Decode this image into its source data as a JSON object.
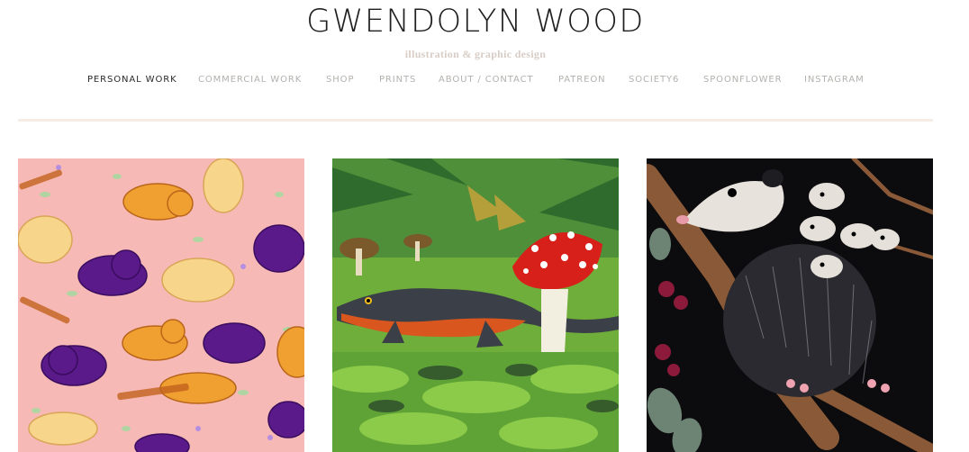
{
  "site": {
    "title": "GWENDOLYN WOOD",
    "tagline": "illustration & graphic design"
  },
  "nav": {
    "items": [
      {
        "label": "PERSONAL WORK",
        "active": true
      },
      {
        "label": "COMMERCIAL WORK",
        "active": false
      },
      {
        "label": "SHOP",
        "active": false
      },
      {
        "label": "PRINTS",
        "active": false
      },
      {
        "label": "ABOUT / CONTACT",
        "active": false
      },
      {
        "label": "PATREON",
        "active": false
      },
      {
        "label": "SOCIETY6",
        "active": false
      },
      {
        "label": "SPOONFLOWER",
        "active": false
      },
      {
        "label": "INSTAGRAM",
        "active": false
      }
    ]
  },
  "gallery": {
    "items": [
      {
        "subject": "cats-pattern"
      },
      {
        "subject": "newt-mushroom"
      },
      {
        "subject": "opossums"
      }
    ]
  },
  "colors": {
    "title": "#1e1e1e",
    "tagline": "#d8cdc6",
    "nav_inactive": "#b4b1ad",
    "nav_active": "#2a2a2a",
    "divider": "#f5ece6",
    "cats_bg": "#f7b9b6",
    "forest_bg": "#6fae3a",
    "opossum_bg": "#0c0b0d"
  }
}
